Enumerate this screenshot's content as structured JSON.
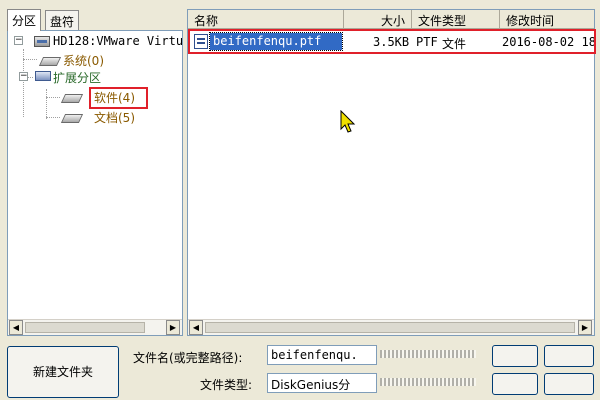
{
  "tabs": [
    "分区",
    "盘符"
  ],
  "tree": {
    "disk": "HD128:VMware Virtu",
    "system": "系统(0)",
    "extended": "扩展分区",
    "software": "软件(4)",
    "docs": "文档(5)"
  },
  "list": {
    "columns": [
      "名称",
      "大小",
      "文件类型",
      "修改时间"
    ],
    "rows": [
      {
        "name": "beifenfenqu.ptf",
        "size": "3.5KB",
        "ext": "PTF",
        "type": "文件",
        "modified": "2016-08-02 18"
      }
    ]
  },
  "bottom": {
    "new_folder": "新建文件夹",
    "filename_label": "文件名(或完整路径):",
    "filename_value": "beifenfenqu.",
    "filetype_label": "文件类型:",
    "filetype_value": "DiskGenius分"
  },
  "colors": {
    "selection": "#316ac5",
    "annotation": "#e0202a"
  },
  "icons": [
    "hard-disk-icon",
    "partition-icon",
    "extended-partition-icon",
    "file-icon",
    "cursor-icon"
  ]
}
